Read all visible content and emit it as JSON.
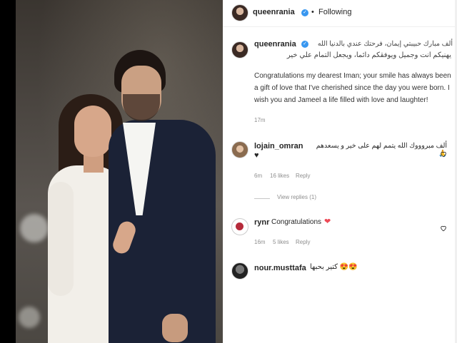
{
  "post": {
    "author": "queenrania",
    "follow_status": "Following",
    "separator": "•",
    "caption_ar_line1": "ألف مبارك حبيبتي إيمان، فرحتك عندي بالدنيا الله",
    "caption_ar_line2": "يهنيكم انت وجميل ويوفقكم دائما، ويجعل التمام علي خير",
    "caption_en": "Congratulations my dearest Iman; your smile has always been a gift of love that I've cherished since the day you were born. I wish you and Jameel a life filled with love and laughter!",
    "time": "17m"
  },
  "comments": [
    {
      "user": "lojain_omran",
      "text": "ألف مبروووك الله يتمم لهم على خير و يسعدهم 🙏",
      "extra": "♥",
      "time": "6m",
      "likes": "16 likes",
      "reply": "Reply",
      "view_replies": "View replies (1)"
    },
    {
      "user": "rynr",
      "text": "Congratulations",
      "emoji": "❤",
      "time": "16m",
      "likes": "5 likes",
      "reply": "Reply"
    },
    {
      "user": "nour.musttafa",
      "text": "😍😍 كتير بحبها"
    }
  ],
  "colors": {
    "verified": "#3897f0",
    "heart": "#ed4956"
  }
}
